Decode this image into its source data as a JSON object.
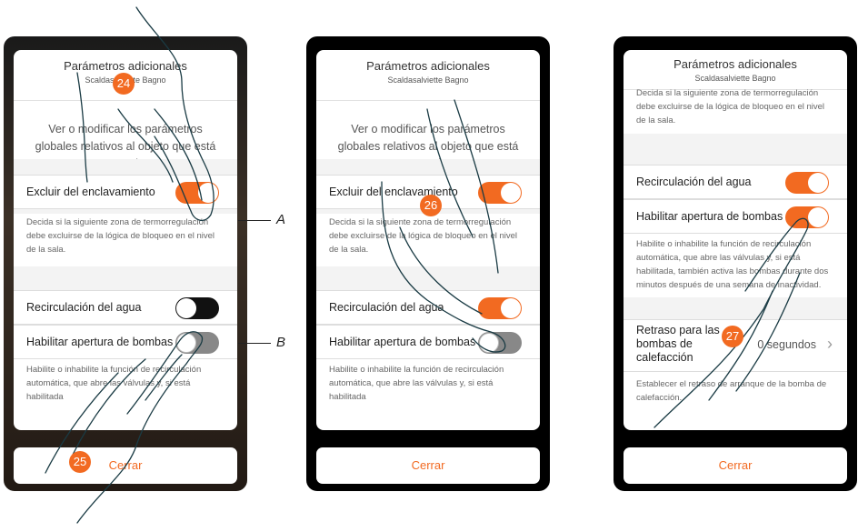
{
  "panel1": {
    "title": "Parámetros adicionales",
    "subtitle": "Scaldasalviette Bagno",
    "intro": "Ver o modificar los parámetros globales relativos al objeto que está creando.",
    "row1_label": "Excluir del enclavamiento",
    "row1_desc": "Decida si la siguiente zona de termorregulación debe excluirse de la lógica de bloqueo en el nivel de la sala.",
    "row2_label": "Recirculación del agua",
    "row3_label": "Habilitar apertura de bombas",
    "row3_desc": "Habilite o inhabilite la función de recirculación automática, que abre las válvulas y, si está habilitada",
    "close_label": "Cerrar",
    "step": "24",
    "step2": "25",
    "callout_a": "A",
    "callout_b": "B"
  },
  "panel2": {
    "title": "Parámetros adicionales",
    "subtitle": "Scaldasalviette Bagno",
    "intro": "Ver o modificar los parámetros globales relativos al objeto que está creando.",
    "row1_label": "Excluir del enclavamiento",
    "row1_desc": "Decida si la siguiente zona de termorregulación debe excluirse de la lógica de bloqueo en el nivel de la sala.",
    "row2_label": "Recirculación del agua",
    "row3_label": "Habilitar apertura de bombas",
    "row3_desc": "Habilite o inhabilite la función de recirculación automática, que abre las válvulas y, si está habilitada",
    "close_label": "Cerrar",
    "step": "26"
  },
  "panel3": {
    "title": "Parámetros adicionales",
    "subtitle": "Scaldasalviette Bagno",
    "top_desc": "Decida si la siguiente zona de termorregulación debe excluirse de la lógica de bloqueo en el nivel de la sala.",
    "row1_label": "Recirculación del agua",
    "row2_label": "Habilitar apertura de bombas",
    "row2_desc": "Habilite o inhabilite la función de recirculación automática, que abre las válvulas y, si está habilitada, también activa las bombas durante dos minutos después de una semana de inactividad.",
    "row3_label": "Retraso para las bombas de calefacción",
    "row3_value": "0 segundos",
    "row3_desc": "Establecer el retraso de arranque de la bomba de calefacción.",
    "close_label": "Cerrar",
    "step": "27"
  },
  "colors": {
    "accent": "#f26a21",
    "toggle_off_dark": "#111111",
    "toggle_off_grey": "#888888"
  }
}
